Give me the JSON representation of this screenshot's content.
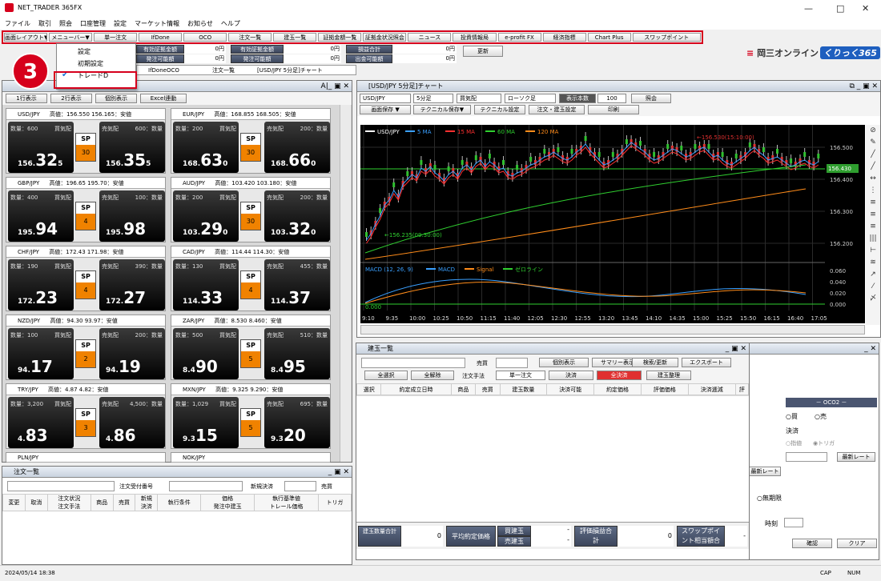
{
  "window": {
    "title": "NET_TRADER 365FX"
  },
  "menu": [
    "ファイル",
    "取引",
    "照会",
    "口座管理",
    "設定",
    "マーケット情報",
    "お知らせ",
    "ヘルプ"
  ],
  "toolbar": [
    "画面レイアウト▼",
    "メニューバー▼",
    "単一注文",
    "IfDone",
    "OCO",
    "注文一覧",
    "建玉一覧",
    "証拠金額一覧",
    "証拠金状況照会",
    "ニュース",
    "投資情報局",
    "e-profit FX",
    "経済指標",
    "Chart Plus",
    "スワップポイント"
  ],
  "info": [
    {
      "label": "有効証拠金額",
      "value": "0円"
    },
    {
      "label": "発注可能額",
      "value": "0円"
    },
    {
      "label": "損益合計",
      "value": "0円"
    },
    {
      "label": "出金可能額",
      "value": "0円"
    }
  ],
  "update_btn": "更新",
  "dropdown": {
    "items": [
      "設定",
      "初期設定",
      "トレードD"
    ]
  },
  "badge": "3",
  "logo": {
    "okasan": "岡三オンライン",
    "kuri": "くりっく365"
  },
  "ordertabs": [
    "IfDoneOCO",
    "注文一覧",
    "[USD/JPY 5分足]チャート"
  ],
  "trade": {
    "buttons": [
      "1行表示",
      "2行表示",
      "個別表示",
      "Excel連動"
    ],
    "tiles": [
      {
        "pair": "USD/JPY",
        "info": "高値：156.550  156.165：安値",
        "bid_qty": "数量：600",
        "ask_qty": "600：数量",
        "bl": "買気配",
        "al": "売気配",
        "bid_pre": "156.",
        "bid_big": "32",
        "bid_sm": "5",
        "sp": "30",
        "ask_pre": "156.",
        "ask_big": "35",
        "ask_sm": "5"
      },
      {
        "pair": "EUR/JPY",
        "info": "高値：168.855  168.505：安値",
        "bid_qty": "数量：200",
        "ask_qty": "200：数量",
        "bl": "買気配",
        "al": "売気配",
        "bid_pre": "168.",
        "bid_big": "63",
        "bid_sm": "0",
        "sp": "30",
        "ask_pre": "168.",
        "ask_big": "66",
        "ask_sm": "0"
      },
      {
        "pair": "GBP/JPY",
        "info": "高値：196.65  195.70：安値",
        "bid_qty": "数量：400",
        "ask_qty": "100：数量",
        "bl": "買気配",
        "al": "売気配",
        "bid_pre": "195.",
        "bid_big": "94",
        "bid_sm": "",
        "sp": "4",
        "ask_pre": "195.",
        "ask_big": "98",
        "ask_sm": ""
      },
      {
        "pair": "AUD/JPY",
        "info": "高値：103.420  103.180：安値",
        "bid_qty": "数量：200",
        "ask_qty": "200：数量",
        "bl": "買気配",
        "al": "売気配",
        "bid_pre": "103.",
        "bid_big": "29",
        "bid_sm": "0",
        "sp": "30",
        "ask_pre": "103.",
        "ask_big": "32",
        "ask_sm": "0"
      },
      {
        "pair": "CHF/JPY",
        "info": "高値：172.43  171.98：安値",
        "bid_qty": "数量：190",
        "ask_qty": "390：数量",
        "bl": "買気配",
        "al": "売気配",
        "bid_pre": "172.",
        "bid_big": "23",
        "bid_sm": "",
        "sp": "4",
        "ask_pre": "172.",
        "ask_big": "27",
        "ask_sm": ""
      },
      {
        "pair": "CAD/JPY",
        "info": "高値：114.44  114.30：安値",
        "bid_qty": "数量：130",
        "ask_qty": "455：数量",
        "bl": "買気配",
        "al": "売気配",
        "bid_pre": "114.",
        "bid_big": "33",
        "bid_sm": "",
        "sp": "4",
        "ask_pre": "114.",
        "ask_big": "37",
        "ask_sm": ""
      },
      {
        "pair": "NZD/JPY",
        "info": "高値：94.30  93.97：安値",
        "bid_qty": "数量：100",
        "ask_qty": "200：数量",
        "bl": "買気配",
        "al": "売気配",
        "bid_pre": "94.",
        "bid_big": "17",
        "bid_sm": "",
        "sp": "2",
        "ask_pre": "94.",
        "ask_big": "19",
        "ask_sm": ""
      },
      {
        "pair": "ZAR/JPY",
        "info": "高値：8.530  8.460：安値",
        "bid_qty": "数量：500",
        "ask_qty": "510：数量",
        "bl": "買気配",
        "al": "売気配",
        "bid_pre": "8.4",
        "bid_big": "90",
        "bid_sm": "",
        "sp": "5",
        "ask_pre": "8.4",
        "ask_big": "95",
        "ask_sm": ""
      },
      {
        "pair": "TRY/JPY",
        "info": "高値：4.87  4.82：安値",
        "bid_qty": "数量：3,200",
        "ask_qty": "4,500：数量",
        "bl": "買気配",
        "al": "売気配",
        "bid_pre": "4.",
        "bid_big": "83",
        "bid_sm": "",
        "sp": "3",
        "ask_pre": "4.",
        "ask_big": "86",
        "ask_sm": ""
      },
      {
        "pair": "MXN/JPY",
        "info": "高値：9.325  9.290：安値",
        "bid_qty": "数量：1,029",
        "ask_qty": "695：数量",
        "bl": "買気配",
        "al": "売気配",
        "bid_pre": "9.3",
        "bid_big": "15",
        "bid_sm": "",
        "sp": "5",
        "ask_pre": "9.3",
        "ask_big": "20",
        "ask_sm": ""
      }
    ],
    "partial": [
      "PLN/JPY",
      "NOK/JPY"
    ]
  },
  "orders": {
    "title": "注文一覧",
    "filter_label": "注文受付番号",
    "new_label": "新規決済",
    "side_label": "売買",
    "headers": [
      [
        "変更"
      ],
      [
        "取消"
      ],
      [
        "注文状況",
        "注文手法"
      ],
      [
        "商品"
      ],
      [
        "売買"
      ],
      [
        "新規",
        "決済"
      ],
      [
        "執行条件"
      ],
      [
        "価格",
        "発注中建玉"
      ],
      [
        "執行基準値",
        "トレール価格"
      ],
      [
        "トリガ"
      ]
    ]
  },
  "chart": {
    "title": "[USD/JPY 5分足]チャート",
    "controls": [
      "USD/JPY",
      "5分足",
      "買気配",
      "ローソク足",
      "表示本数",
      "100",
      "照会"
    ],
    "controls2": [
      "画面保存 ▼",
      "テクニカル保存▼",
      "テクニカル設定",
      "注文・建玉設定",
      "印刷"
    ],
    "legend": [
      {
        "name": "USD/JPY",
        "color": "#ffffff"
      },
      {
        "name": "5 MA",
        "color": "#3aa0ff"
      },
      {
        "name": "15 MA",
        "color": "#ff3030"
      },
      {
        "name": "60 MA",
        "color": "#30d030"
      },
      {
        "name": "120 MA",
        "color": "#ff8c1a"
      }
    ],
    "y_labels": [
      "156.500",
      "156.400",
      "156.300",
      "156.200"
    ],
    "price_tag": "156.430",
    "hi_note": "←156.530(15:10:00)",
    "lo_note": "←156.235(09:30:00)",
    "macd_title": "MACD (12, 26, 9)",
    "macd_legend": [
      {
        "name": "MACD",
        "color": "#3aa0ff"
      },
      {
        "name": "Signal",
        "color": "#ff8c1a"
      },
      {
        "name": "ゼロライン",
        "color": "#30d030"
      }
    ],
    "macd_y": [
      "0.060",
      "0.040",
      "0.020",
      "0.000"
    ],
    "macd_zero": "0.000",
    "x_labels": [
      "9:10",
      "9:35",
      "10:00",
      "10:25",
      "10:50",
      "11:15",
      "11:40",
      "12:05",
      "12:30",
      "12:55",
      "13:20",
      "13:45",
      "14:10",
      "14:35",
      "15:00",
      "15:25",
      "15:50",
      "16:15",
      "16:40",
      "17:05"
    ]
  },
  "positions": {
    "title": "建玉一覧",
    "side": "売買",
    "buttons": [
      "個別表示",
      "サマリー表示",
      "検索/更新",
      "エクスポート"
    ],
    "buttons2": [
      "全選択",
      "全解除",
      "注文手法",
      "単一注文",
      "決済",
      "全決済",
      "建玉整理"
    ],
    "headers": [
      "選択",
      "約定成立日時",
      "商品",
      "売買",
      "建玉数量",
      "決済可能",
      "約定価格",
      "評価価格",
      "決済逓減",
      "評"
    ],
    "footer": [
      {
        "label": "建玉数量合計",
        "value": "0"
      },
      {
        "label": "平均約定価格",
        "value": ""
      },
      {
        "label": "買建玉",
        "value": "-"
      },
      {
        "label": "売建玉",
        "value": "-"
      },
      {
        "label": "評価損益合計",
        "value": "0"
      },
      {
        "label": "スワップポイント相当額合計",
        "value": "-"
      }
    ]
  },
  "oco": {
    "header": "－ OCO2 －",
    "buy": "買",
    "sell": "売",
    "settle": "決済",
    "limit": "指値",
    "trigger": "トリガ",
    "latest": "最新レート",
    "latest2": "最新レート",
    "forever": "無期限",
    "time": "時刻",
    "confirm": "確認",
    "clear": "クリア"
  },
  "status": {
    "datetime": "2024/05/14 18:38",
    "cap": "CAP",
    "num": "NUM"
  }
}
